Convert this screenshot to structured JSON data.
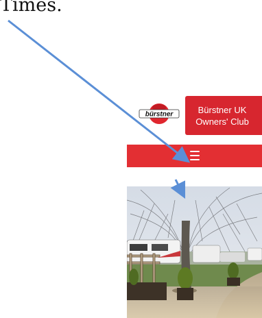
{
  "document": {
    "fragment_text": "Times."
  },
  "site": {
    "logo_text": "bürstner",
    "club_name_line1": "Bürstner UK",
    "club_name_line2": "Owners' Club",
    "menu_icon": "hamburger-icon"
  },
  "colors": {
    "brand_red": "#e32f33",
    "banner_red": "#d7262f",
    "annotation_arrow": "#5b8fd6"
  }
}
